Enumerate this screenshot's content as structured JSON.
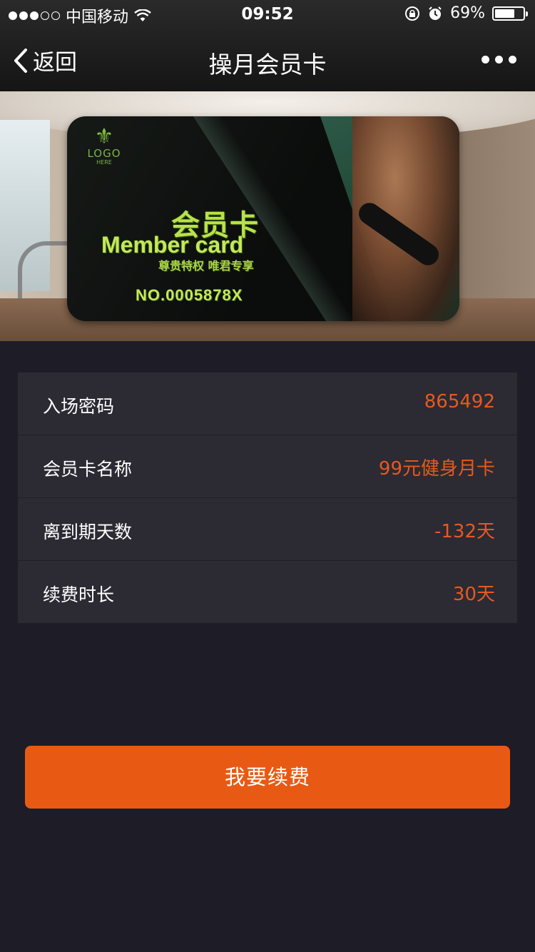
{
  "status_bar": {
    "carrier": "中国移动",
    "time": "09:52",
    "battery": "69%",
    "battery_level": 0.69
  },
  "nav": {
    "back_label": "返回",
    "title": "操月会员卡"
  },
  "card": {
    "logo_text": "LOGO",
    "logo_sub": "HERE",
    "title_cn": "会员卡",
    "title_en": "Member card",
    "slogan": "尊贵特权 唯君专享",
    "number": "NO.0005878X"
  },
  "info_rows": [
    {
      "label": "入场密码",
      "value": "865492"
    },
    {
      "label": "会员卡名称",
      "value": "99元健身月卡"
    },
    {
      "label": "离到期天数",
      "value": "-132天"
    },
    {
      "label": "续费时长",
      "value": "30天"
    }
  ],
  "renew_button": "我要续费",
  "colors": {
    "accent": "#e85a14",
    "value_text": "#e55a20",
    "background": "#1e1c26",
    "row_background": "#2c2a33"
  }
}
